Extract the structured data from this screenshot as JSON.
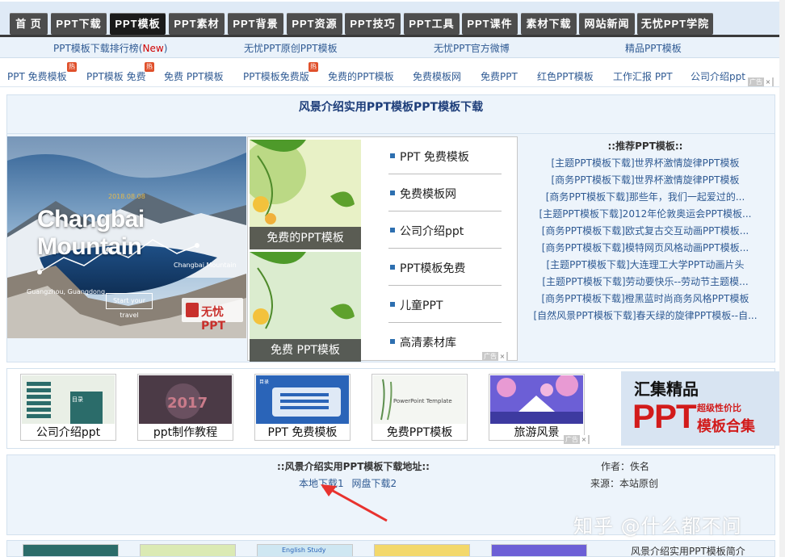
{
  "nav": {
    "tabs": [
      {
        "label": "首 页",
        "active": false
      },
      {
        "label": "PPT下载",
        "active": false
      },
      {
        "label": "PPT模板",
        "active": true
      },
      {
        "label": "PPT素材",
        "active": false
      },
      {
        "label": "PPT背景",
        "active": false
      },
      {
        "label": "PPT资源",
        "active": false
      },
      {
        "label": "PPT技巧",
        "active": false
      },
      {
        "label": "PPT工具",
        "active": false
      },
      {
        "label": "PPT课件",
        "active": false
      },
      {
        "label": "素材下载",
        "active": false
      },
      {
        "label": "网站新闻",
        "active": false
      },
      {
        "label": "无忧PPT学院",
        "active": false
      }
    ]
  },
  "subnav": {
    "links": [
      {
        "label": "PPT模板下载排行榜(",
        "new": "New",
        "tail": ")"
      },
      {
        "label": "无忧PPT原创PPT模板"
      },
      {
        "label": "无忧PPT官方微博"
      },
      {
        "label": "精品PPT模板"
      }
    ]
  },
  "keywords": {
    "items": [
      {
        "label": "PPT 免费模板",
        "hot": true
      },
      {
        "label": "PPT模板 免费",
        "hot": true
      },
      {
        "label": "免费 PPT模板",
        "hot": false
      },
      {
        "label": "PPT模板免费版",
        "hot": true
      },
      {
        "label": "免费的PPT模板",
        "hot": false
      },
      {
        "label": "免费模板网",
        "hot": false
      },
      {
        "label": "免费PPT",
        "hot": false
      },
      {
        "label": "红色PPT模板",
        "hot": false
      },
      {
        "label": "工作汇报 PPT",
        "hot": false
      },
      {
        "label": "公司介绍ppt",
        "hot": false
      }
    ],
    "hot_label": "热",
    "ad_label": "广告",
    "close_label": "×"
  },
  "main": {
    "title": "风景介绍实用PPT模板PPT模板下载",
    "hero": {
      "heading": "Changbai Mountain",
      "date_label": "2018.08.08",
      "place_label": "Changbai Mountain",
      "left_label": "Guangzhou, Guangdong",
      "button_label": "Start your travel",
      "logo_label": "无忧PPT"
    },
    "ad_tiles": [
      {
        "caption": "免费的PPT模板"
      },
      {
        "caption": "免费 PPT模板"
      }
    ],
    "ad_links": [
      {
        "label": "PPT 免费模板"
      },
      {
        "label": "免费模板网"
      },
      {
        "label": "公司介绍ppt"
      },
      {
        "label": "PPT模板免费"
      },
      {
        "label": "儿童PPT"
      },
      {
        "label": "高清素材库"
      }
    ],
    "recommend": {
      "heading": "::推荐PPT模板::",
      "items": [
        "[主题PPT模板下载]世界杯激情旋律PPT模板",
        "[商务PPT模板下载]世界杯激情旋律PPT模板",
        "[商务PPT模板下载]那些年，我们一起爱过的...",
        "[主题PPT模板下载]2012年伦敦奥运会PPT模板...",
        "[商务PPT模板下载]欧式复古交互动画PPT模板...",
        "[商务PPT模板下载]模特网页风格动画PPT模板...",
        "[主题PPT模板下载]大连理工大学PPT动画片头",
        "[主题PPT模板下载]劳动要快乐--劳动节主题模...",
        "[商务PPT模板下载]橙黑蓝时尚商务风格PPT模板",
        "[自然风景PPT模板下载]春天绿的旋律PPT模板--自..."
      ]
    }
  },
  "strip": {
    "cards": [
      {
        "label": "公司介绍ppt",
        "thumb_text": "目录"
      },
      {
        "label": "ppt制作教程",
        "thumb_text": "2017"
      },
      {
        "label": "PPT 免费模板",
        "thumb_text": "目录"
      },
      {
        "label": "免费PPT模板",
        "thumb_text": "PowerPoint Template"
      },
      {
        "label": "旅游风景",
        "thumb_text": ""
      }
    ],
    "banner": {
      "line1": "汇集精品",
      "line2": "PPT",
      "line3": "超级性价比",
      "line4": "模板合集"
    }
  },
  "download": {
    "title": "::风景介绍实用PPT模板下载地址::",
    "links": [
      "本地下载1",
      "网盘下载2"
    ],
    "author": "作者：佚名",
    "source": "来源：本站原创"
  },
  "watermark": "知乎 @什么都不问",
  "bottom": {
    "intro": "风景介绍实用PPT模板简介",
    "card_text": "English Study"
  }
}
